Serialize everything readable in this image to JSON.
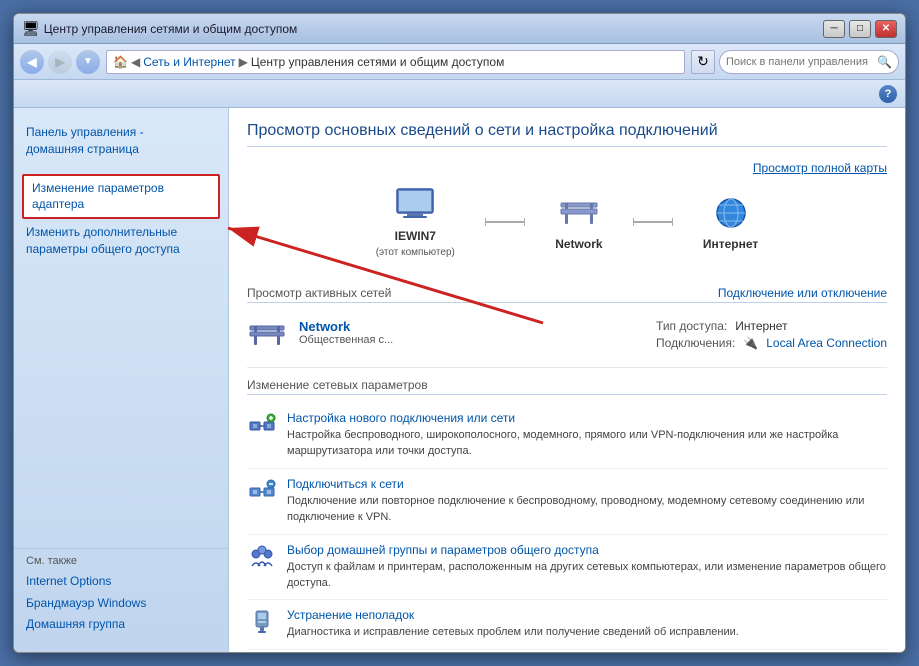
{
  "window": {
    "title": "Центр управления сетями и общим доступом",
    "controls": {
      "minimize": "─",
      "maximize": "□",
      "close": "✕"
    }
  },
  "navbar": {
    "breadcrumb": {
      "root_icon": "🏠",
      "level1": "Сеть и Интернет",
      "level2": "Центр управления сетями и общим доступом"
    },
    "search_placeholder": "Поиск в панели управления"
  },
  "sidebar": {
    "home_line1": "Панель управления -",
    "home_line2": "домашняя страница",
    "nav_items": [
      {
        "id": "change-adapter",
        "label": "Изменение параметров адаптера",
        "active": true
      },
      {
        "id": "change-sharing",
        "label": "Изменить дополнительные параметры общего доступа",
        "active": false
      }
    ],
    "also_title": "См. также",
    "also_links": [
      {
        "id": "internet-options",
        "label": "Internet Options"
      },
      {
        "id": "firewall",
        "label": "Брандмауэр Windows"
      },
      {
        "id": "homegroup",
        "label": "Домашняя группа"
      }
    ]
  },
  "content": {
    "page_title": "Просмотр основных сведений о сети и настройка подключений",
    "map_link": "Просмотр полной карты",
    "network_nodes": [
      {
        "id": "computer",
        "label": "IEWIN7",
        "sublabel": "(этот компьютер)",
        "icon_type": "computer"
      },
      {
        "id": "network",
        "label": "Network",
        "sublabel": "",
        "icon_type": "bench"
      },
      {
        "id": "internet",
        "label": "Интернет",
        "sublabel": "",
        "icon_type": "globe"
      }
    ],
    "active_networks_title": "Просмотр активных сетей",
    "connect_disconnect_link": "Подключение или отключение",
    "active_network": {
      "name": "Network",
      "type": "Общественная с...",
      "access_type_label": "Тип доступа:",
      "access_type_value": "Интернет",
      "connections_label": "Подключения:",
      "connections_value": "Local Area Connection",
      "connection_icon": "🔌"
    },
    "change_settings_title": "Изменение сетевых параметров",
    "settings_items": [
      {
        "id": "new-connection",
        "link": "Настройка нового подключения или сети",
        "desc": "Настройка беспроводного, широкополосного, модемного, прямого или VPN-подключения или же настройка маршрутизатора или точки доступа.",
        "icon_type": "connection"
      },
      {
        "id": "connect-network",
        "link": "Подключиться к сети",
        "desc": "Подключение или повторное подключение к беспроводному, проводному, модемному сетевому соединению или подключение к VPN.",
        "icon_type": "network"
      },
      {
        "id": "homegroup-settings",
        "link": "Выбор домашней группы и параметров общего доступа",
        "desc": "Доступ к файлам и принтерам, расположенным на других сетевых компьютерах, или изменение параметров общего доступа.",
        "icon_type": "homegroup"
      },
      {
        "id": "troubleshoot",
        "link": "Устранение неполадок",
        "desc": "Диагностика и исправление сетевых проблем или получение сведений об исправлении.",
        "icon_type": "tools"
      }
    ]
  },
  "arrow": {
    "visible": true,
    "label": "red arrow pointing from content to sidebar"
  }
}
